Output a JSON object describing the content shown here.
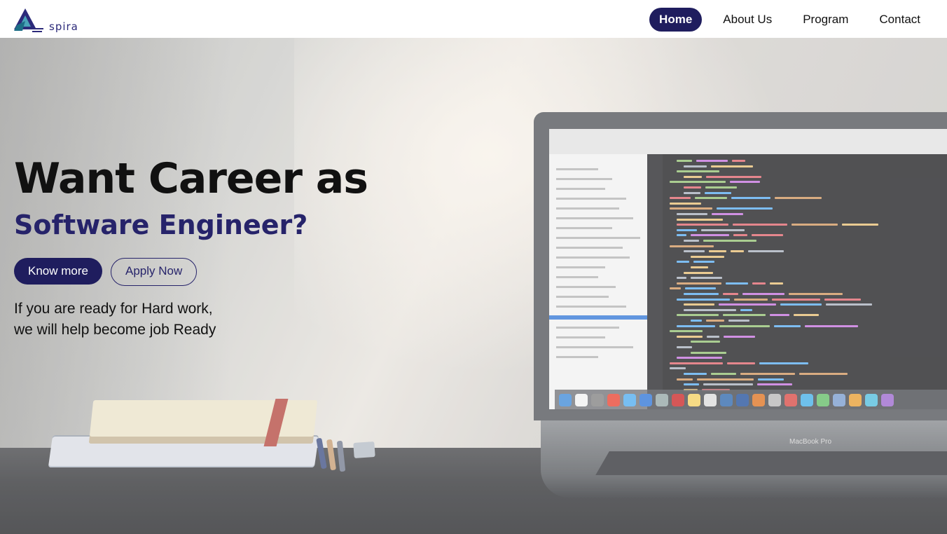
{
  "brand": {
    "name": "spira"
  },
  "page_progress": 0.2,
  "nav": {
    "items": [
      {
        "label": "Home",
        "active": true
      },
      {
        "label": "About Us",
        "active": false
      },
      {
        "label": "Program",
        "active": false
      },
      {
        "label": "Contact",
        "active": false
      }
    ]
  },
  "hero": {
    "headline": "Want Career as",
    "subheadline": "Software Engineer?",
    "primary_button": "Know more",
    "secondary_button": "Apply Now",
    "tagline_line1": "If you are ready for Hard work,",
    "tagline_line2": "we will help become job Ready",
    "laptop_label": "MacBook Pro"
  },
  "colors": {
    "brand_navy": "#1f1d5e",
    "accent_text": "#26236a",
    "progress_blue": "#2a6fd6"
  }
}
